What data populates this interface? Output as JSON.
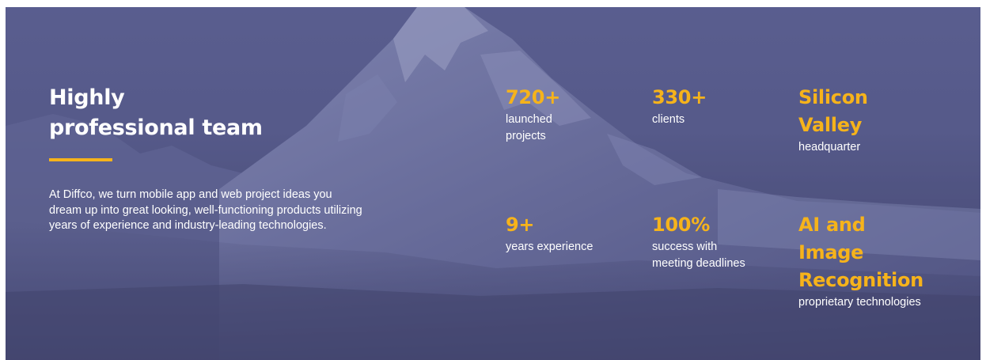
{
  "hero": {
    "heading_line1": "Highly",
    "heading_line2": "professional team",
    "description": "At Diffco, we turn mobile app and web project ideas you dream up into great looking, well-functioning products utilizing years of experience and industry-leading technologies."
  },
  "stats": [
    {
      "value": "720+",
      "label_line1": "launched",
      "label_line2": "projects"
    },
    {
      "value": "330+",
      "label_line1": "clients"
    },
    {
      "value_line1": "Silicon",
      "value_line2": "Valley",
      "label_line1": "headquarter"
    },
    {
      "value": "9+",
      "label_line1": "years experience"
    },
    {
      "value": "100%",
      "label_line1": "success with",
      "label_line2": "meeting deadlines"
    },
    {
      "value_line1": "AI and",
      "value_line2": "Image",
      "value_line3": "Recognition",
      "label_line1": "proprietary technologies"
    }
  ],
  "colors": {
    "accent": "#f6b31b",
    "background": "#585c8c",
    "text": "#ffffff"
  }
}
